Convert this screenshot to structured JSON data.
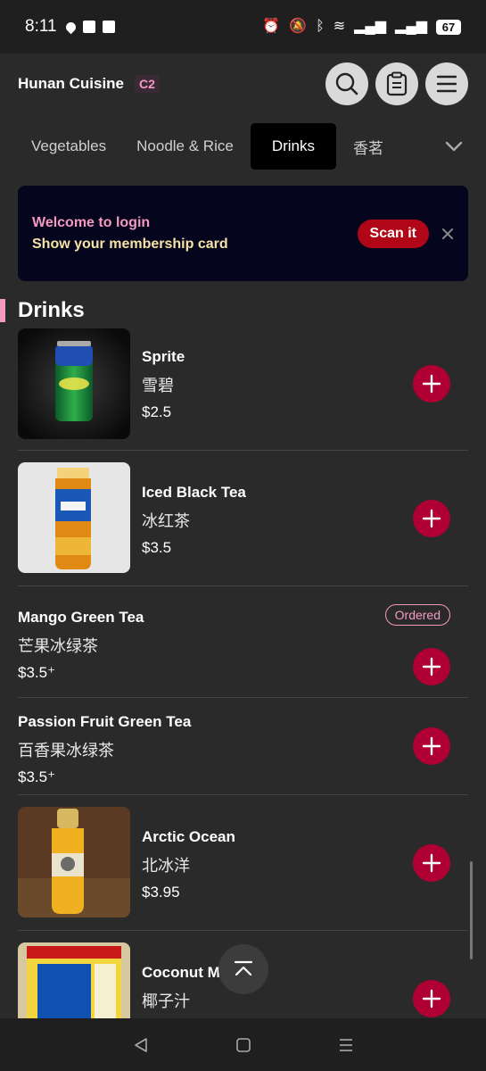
{
  "status_bar": {
    "time": "8:11",
    "battery": "67"
  },
  "header": {
    "store_name": "Hunan Cuisine",
    "table_badge": "C2"
  },
  "tabs": [
    {
      "label": "Vegetables"
    },
    {
      "label": "Noodle & Rice"
    },
    {
      "label": "Drinks",
      "active": true
    },
    {
      "label": "香茗"
    }
  ],
  "banner": {
    "line1": "Welcome to login",
    "line2": "Show your membership card",
    "scan_label": "Scan it"
  },
  "section": {
    "title": "Drinks"
  },
  "items": [
    {
      "name": "Sprite",
      "cn": "雪碧",
      "price": "$2.5"
    },
    {
      "name": "Iced Black Tea",
      "cn": "冰红茶",
      "price": "$3.5"
    },
    {
      "name": "Mango Green Tea",
      "cn": "芒果冰绿茶",
      "price": "$3.5⁺",
      "status": "Ordered"
    },
    {
      "name": "Passion Fruit Green Tea",
      "cn": "百香果冰绿茶",
      "price": "$3.5⁺"
    },
    {
      "name": "Arctic Ocean",
      "cn": "北冰洋",
      "price": "$3.95"
    },
    {
      "name": "Coconut M",
      "cn": "椰子汁",
      "price": ""
    }
  ],
  "colors": {
    "accent_pink": "#f49ac1",
    "add_button": "#b00033",
    "scan_button": "#b00618"
  },
  "icons": [
    "search-icon",
    "clipboard-icon",
    "menu-icon",
    "chevron-down-icon",
    "plus-icon",
    "close-icon",
    "arrow-up-icon"
  ]
}
